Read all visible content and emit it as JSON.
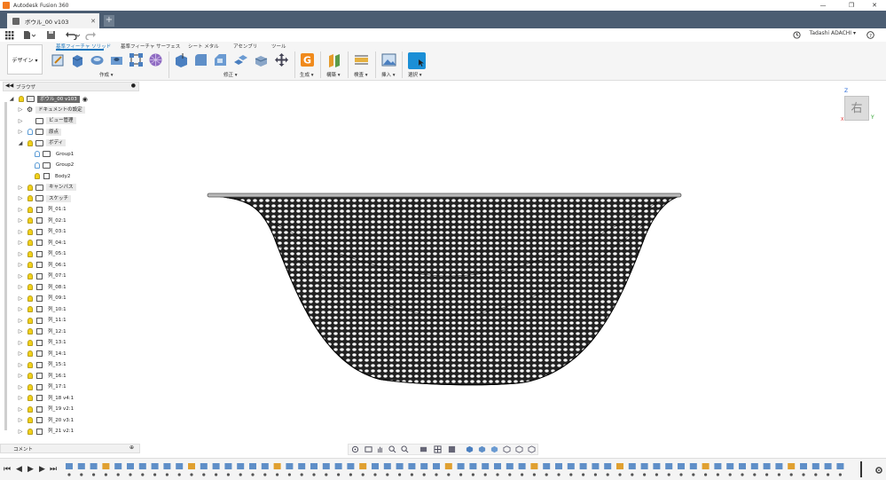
{
  "window": {
    "title": "Autodesk Fusion 360",
    "minimize": "—",
    "maximize": "❐",
    "close": "✕",
    "accent": "#f37a1f"
  },
  "doc_tab": {
    "name": "ボウル_00 v103",
    "close": "✕",
    "new_tab": "+"
  },
  "quick_toolbar": {
    "grid_icon": "grid-icon",
    "file_icon": "file-icon",
    "save_icon": "save-icon",
    "undo_icon": "undo-icon",
    "redo_icon": "redo-icon",
    "user_name": "Tadashi ADACHI ▾",
    "help": "?"
  },
  "ribbon": {
    "workspace": "デザイン ▾",
    "tabs": [
      "基準フィーチャ ソリッド",
      "基準フィーチャ サーフェス",
      "シート メタル",
      "アセンブリ",
      "ツール"
    ],
    "active_tab_index": 0,
    "groups": [
      "作成 ▾",
      "修正 ▾",
      "生成 ▾",
      "構築 ▾",
      "検査 ▾",
      "挿入 ▾",
      "選択 ▾"
    ],
    "accent": "#1b76bc"
  },
  "browser": {
    "title": "ブラウザ",
    "root": "ボウル_00 v103",
    "items": [
      {
        "label": "ドキュメントの設定",
        "kind": "gear"
      },
      {
        "label": "ビュー管理",
        "kind": "folder"
      },
      {
        "label": "原点",
        "kind": "folder"
      },
      {
        "label": "ボディ",
        "kind": "folder"
      },
      {
        "label": "Group1",
        "kind": "sub"
      },
      {
        "label": "Group2",
        "kind": "sub"
      },
      {
        "label": "Body2",
        "kind": "body"
      },
      {
        "label": "キャンバス",
        "kind": "folder"
      },
      {
        "label": "スケッチ",
        "kind": "folder"
      },
      {
        "label": "列_01:1",
        "kind": "comp"
      },
      {
        "label": "列_02:1",
        "kind": "comp"
      },
      {
        "label": "列_03:1",
        "kind": "comp"
      },
      {
        "label": "列_04:1",
        "kind": "comp"
      },
      {
        "label": "列_05:1",
        "kind": "comp"
      },
      {
        "label": "列_06:1",
        "kind": "comp"
      },
      {
        "label": "列_07:1",
        "kind": "comp"
      },
      {
        "label": "列_08:1",
        "kind": "comp"
      },
      {
        "label": "列_09:1",
        "kind": "comp"
      },
      {
        "label": "列_10:1",
        "kind": "comp"
      },
      {
        "label": "列_11:1",
        "kind": "comp"
      },
      {
        "label": "列_12:1",
        "kind": "comp"
      },
      {
        "label": "列_13:1",
        "kind": "comp"
      },
      {
        "label": "列_14:1",
        "kind": "comp"
      },
      {
        "label": "列_15:1",
        "kind": "comp"
      },
      {
        "label": "列_16:1",
        "kind": "comp"
      },
      {
        "label": "列_17:1",
        "kind": "comp"
      },
      {
        "label": "列_18 v4:1",
        "kind": "comp"
      },
      {
        "label": "列_19 v2:1",
        "kind": "comp"
      },
      {
        "label": "列_20 v3:1",
        "kind": "comp"
      },
      {
        "label": "列_21 v2:1",
        "kind": "comp"
      }
    ]
  },
  "comments": {
    "title": "コメント"
  },
  "viewcube": {
    "face_label": "右",
    "axis_z": "Z",
    "axis_y": "Y",
    "axis_x": "X"
  },
  "timeline": {
    "first": "⏮",
    "prev": "◀",
    "play": "▶",
    "next": "▶",
    "last": "⏭"
  }
}
